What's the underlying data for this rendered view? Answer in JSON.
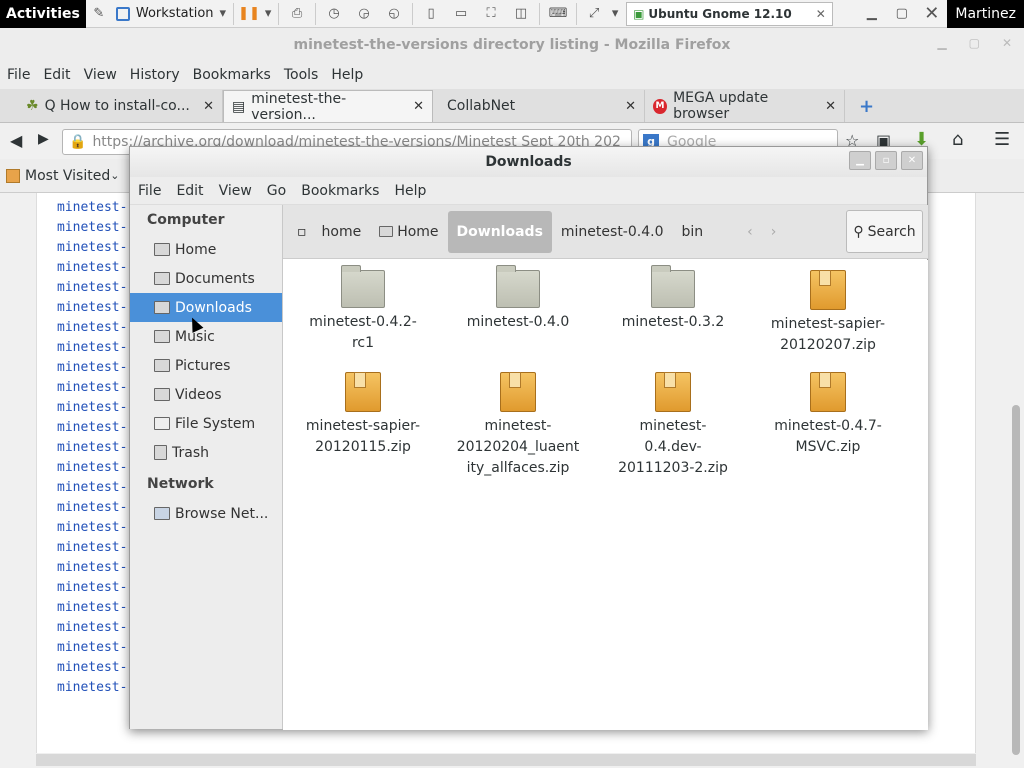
{
  "topbar": {
    "activities": "Activities",
    "workstation": "Workstation",
    "vm_title": "Ubuntu Gnome 12.10",
    "user": "Martinez"
  },
  "firefox": {
    "window_title": "minetest-the-versions directory listing - Mozilla Firefox",
    "menu": [
      "File",
      "Edit",
      "View",
      "History",
      "Bookmarks",
      "Tools",
      "Help"
    ],
    "tabs": [
      {
        "label": "Q How to install-co...",
        "active": false
      },
      {
        "label": "minetest-the-version...",
        "active": true
      },
      {
        "label": "CollabNet",
        "active": false
      },
      {
        "label": "MEGA update browser",
        "active": false
      }
    ],
    "url": "https://archive.org/download/minetest-the-versions/Minetest Sept 20th 202",
    "search_placeholder": "Google",
    "bookmarks_label": "Most Visited",
    "listing_items": [
      "minetest-",
      "minetest-",
      "minetest-",
      "minetest-",
      "minetest-",
      "minetest-",
      "minetest-",
      "minetest-",
      "minetest-",
      "minetest-",
      "minetest-",
      "minetest-",
      "minetest-",
      "minetest-",
      "minetest-",
      "minetest-",
      "minetest-",
      "minetest-",
      "minetest-",
      "minetest-",
      "minetest-",
      "minetest-",
      "minetest-",
      "minetest-",
      "minetest-"
    ]
  },
  "nautilus": {
    "title": "Downloads",
    "menu": [
      "File",
      "Edit",
      "View",
      "Go",
      "Bookmarks",
      "Help"
    ],
    "sidebar": {
      "computer_heading": "Computer",
      "items": [
        {
          "label": "Home",
          "icon": "home-folder-icon"
        },
        {
          "label": "Documents",
          "icon": "documents-folder-icon"
        },
        {
          "label": "Downloads",
          "icon": "downloads-folder-icon",
          "selected": true
        },
        {
          "label": "Music",
          "icon": "music-folder-icon"
        },
        {
          "label": "Pictures",
          "icon": "pictures-folder-icon"
        },
        {
          "label": "Videos",
          "icon": "videos-folder-icon"
        },
        {
          "label": "File System",
          "icon": "drive-icon"
        },
        {
          "label": "Trash",
          "icon": "trash-icon"
        }
      ],
      "network_heading": "Network",
      "network_items": [
        {
          "label": "Browse Net...",
          "icon": "network-icon"
        }
      ]
    },
    "path": [
      "home",
      "Home",
      "Downloads",
      "minetest-0.4.0",
      "bin"
    ],
    "search_label": "Search",
    "files": [
      {
        "name": "minetest-0.4.2-rc1",
        "type": "folder"
      },
      {
        "name": "minetest-0.4.0",
        "type": "folder"
      },
      {
        "name": "minetest-0.3.2",
        "type": "folder"
      },
      {
        "name": "minetest-sapier-20120207.zip",
        "type": "zip"
      },
      {
        "name": "minetest-sapier-20120115.zip",
        "type": "zip"
      },
      {
        "name": "minetest-20120204_luaentity_allfaces.zip",
        "type": "zip"
      },
      {
        "name": "minetest-0.4.dev-20111203-2.zip",
        "type": "zip"
      },
      {
        "name": "minetest-0.4.7-MSVC.zip",
        "type": "zip"
      }
    ]
  }
}
